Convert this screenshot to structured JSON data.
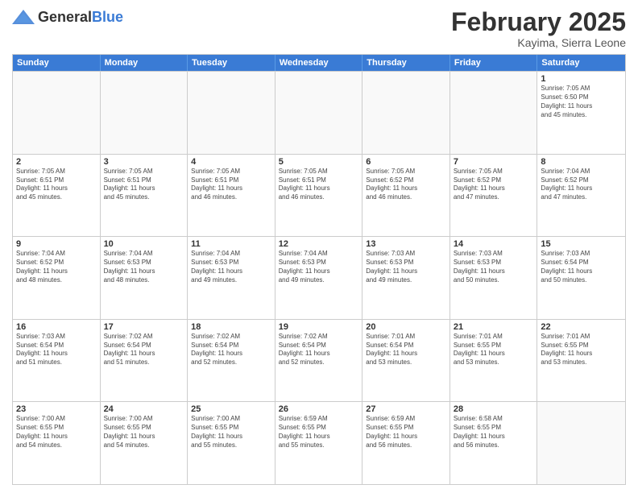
{
  "header": {
    "logo_general": "General",
    "logo_blue": "Blue",
    "month_title": "February 2025",
    "location": "Kayima, Sierra Leone"
  },
  "weekdays": [
    "Sunday",
    "Monday",
    "Tuesday",
    "Wednesday",
    "Thursday",
    "Friday",
    "Saturday"
  ],
  "rows": [
    [
      {
        "day": "",
        "info": ""
      },
      {
        "day": "",
        "info": ""
      },
      {
        "day": "",
        "info": ""
      },
      {
        "day": "",
        "info": ""
      },
      {
        "day": "",
        "info": ""
      },
      {
        "day": "",
        "info": ""
      },
      {
        "day": "1",
        "info": "Sunrise: 7:05 AM\nSunset: 6:50 PM\nDaylight: 11 hours\nand 45 minutes."
      }
    ],
    [
      {
        "day": "2",
        "info": "Sunrise: 7:05 AM\nSunset: 6:51 PM\nDaylight: 11 hours\nand 45 minutes."
      },
      {
        "day": "3",
        "info": "Sunrise: 7:05 AM\nSunset: 6:51 PM\nDaylight: 11 hours\nand 45 minutes."
      },
      {
        "day": "4",
        "info": "Sunrise: 7:05 AM\nSunset: 6:51 PM\nDaylight: 11 hours\nand 46 minutes."
      },
      {
        "day": "5",
        "info": "Sunrise: 7:05 AM\nSunset: 6:51 PM\nDaylight: 11 hours\nand 46 minutes."
      },
      {
        "day": "6",
        "info": "Sunrise: 7:05 AM\nSunset: 6:52 PM\nDaylight: 11 hours\nand 46 minutes."
      },
      {
        "day": "7",
        "info": "Sunrise: 7:05 AM\nSunset: 6:52 PM\nDaylight: 11 hours\nand 47 minutes."
      },
      {
        "day": "8",
        "info": "Sunrise: 7:04 AM\nSunset: 6:52 PM\nDaylight: 11 hours\nand 47 minutes."
      }
    ],
    [
      {
        "day": "9",
        "info": "Sunrise: 7:04 AM\nSunset: 6:52 PM\nDaylight: 11 hours\nand 48 minutes."
      },
      {
        "day": "10",
        "info": "Sunrise: 7:04 AM\nSunset: 6:53 PM\nDaylight: 11 hours\nand 48 minutes."
      },
      {
        "day": "11",
        "info": "Sunrise: 7:04 AM\nSunset: 6:53 PM\nDaylight: 11 hours\nand 49 minutes."
      },
      {
        "day": "12",
        "info": "Sunrise: 7:04 AM\nSunset: 6:53 PM\nDaylight: 11 hours\nand 49 minutes."
      },
      {
        "day": "13",
        "info": "Sunrise: 7:03 AM\nSunset: 6:53 PM\nDaylight: 11 hours\nand 49 minutes."
      },
      {
        "day": "14",
        "info": "Sunrise: 7:03 AM\nSunset: 6:53 PM\nDaylight: 11 hours\nand 50 minutes."
      },
      {
        "day": "15",
        "info": "Sunrise: 7:03 AM\nSunset: 6:54 PM\nDaylight: 11 hours\nand 50 minutes."
      }
    ],
    [
      {
        "day": "16",
        "info": "Sunrise: 7:03 AM\nSunset: 6:54 PM\nDaylight: 11 hours\nand 51 minutes."
      },
      {
        "day": "17",
        "info": "Sunrise: 7:02 AM\nSunset: 6:54 PM\nDaylight: 11 hours\nand 51 minutes."
      },
      {
        "day": "18",
        "info": "Sunrise: 7:02 AM\nSunset: 6:54 PM\nDaylight: 11 hours\nand 52 minutes."
      },
      {
        "day": "19",
        "info": "Sunrise: 7:02 AM\nSunset: 6:54 PM\nDaylight: 11 hours\nand 52 minutes."
      },
      {
        "day": "20",
        "info": "Sunrise: 7:01 AM\nSunset: 6:54 PM\nDaylight: 11 hours\nand 53 minutes."
      },
      {
        "day": "21",
        "info": "Sunrise: 7:01 AM\nSunset: 6:55 PM\nDaylight: 11 hours\nand 53 minutes."
      },
      {
        "day": "22",
        "info": "Sunrise: 7:01 AM\nSunset: 6:55 PM\nDaylight: 11 hours\nand 53 minutes."
      }
    ],
    [
      {
        "day": "23",
        "info": "Sunrise: 7:00 AM\nSunset: 6:55 PM\nDaylight: 11 hours\nand 54 minutes."
      },
      {
        "day": "24",
        "info": "Sunrise: 7:00 AM\nSunset: 6:55 PM\nDaylight: 11 hours\nand 54 minutes."
      },
      {
        "day": "25",
        "info": "Sunrise: 7:00 AM\nSunset: 6:55 PM\nDaylight: 11 hours\nand 55 minutes."
      },
      {
        "day": "26",
        "info": "Sunrise: 6:59 AM\nSunset: 6:55 PM\nDaylight: 11 hours\nand 55 minutes."
      },
      {
        "day": "27",
        "info": "Sunrise: 6:59 AM\nSunset: 6:55 PM\nDaylight: 11 hours\nand 56 minutes."
      },
      {
        "day": "28",
        "info": "Sunrise: 6:58 AM\nSunset: 6:55 PM\nDaylight: 11 hours\nand 56 minutes."
      },
      {
        "day": "",
        "info": ""
      }
    ]
  ]
}
